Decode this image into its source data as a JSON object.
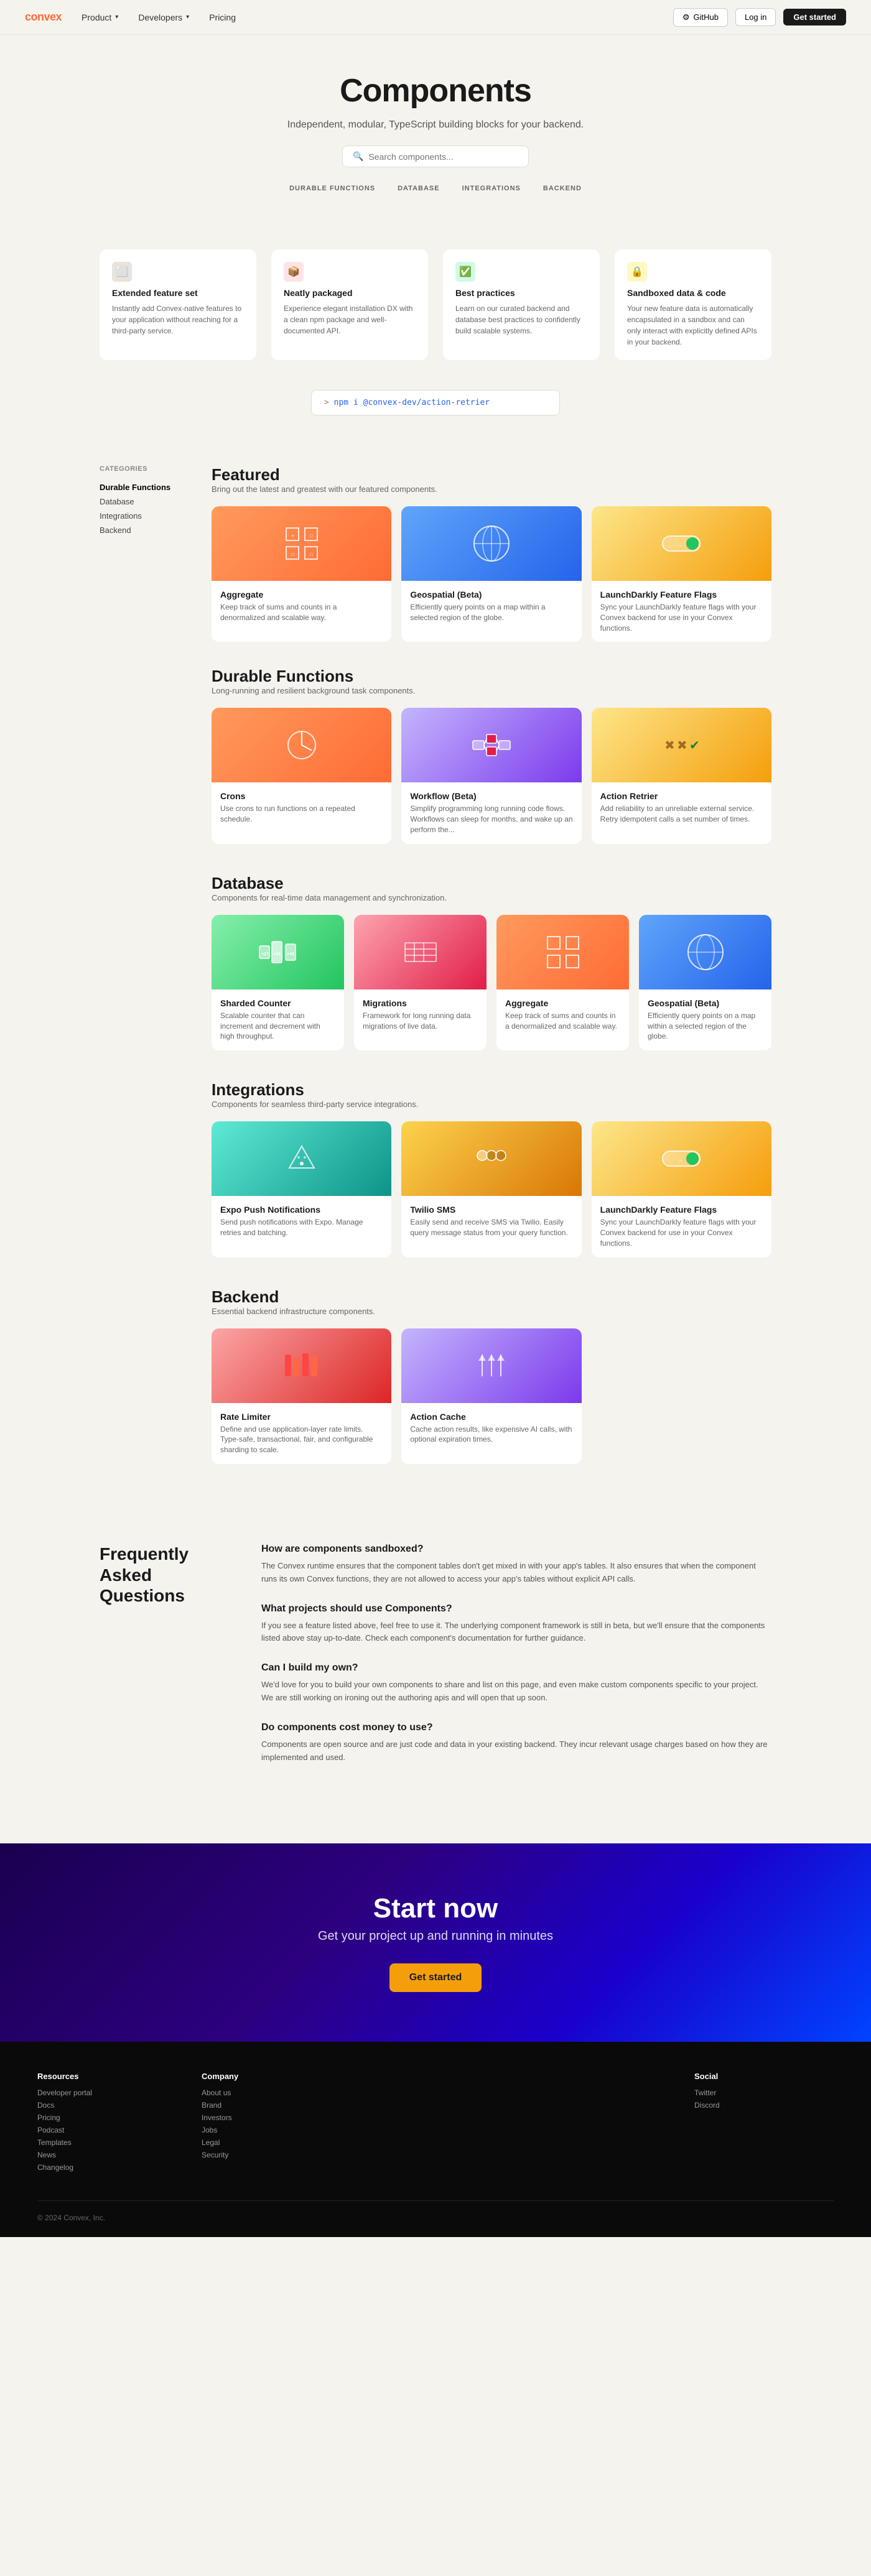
{
  "navbar": {
    "logo": "convex",
    "items": [
      {
        "label": "Product",
        "has_dropdown": true
      },
      {
        "label": "Developers",
        "has_dropdown": true
      },
      {
        "label": "Pricing",
        "has_dropdown": false
      }
    ],
    "github_label": "GitHub",
    "login_label": "Log in",
    "get_started_label": "Get started"
  },
  "hero": {
    "title": "Components",
    "subtitle": "Independent, modular, TypeScript building blocks for your backend.",
    "search_placeholder": "Search components...",
    "tags": [
      "DURABLE FUNCTIONS",
      "DATABASE",
      "INTEGRATIONS",
      "BACKEND"
    ]
  },
  "npm_command": "npm i @convex-dev/action-retrier",
  "feature_highlights": [
    {
      "icon": "⬜",
      "title": "Extended feature set",
      "desc": "Instantly add Convex-native features to your application without reaching for a third-party service.",
      "bg": "#e8e4dc"
    },
    {
      "icon": "📦",
      "title": "Neatly packaged",
      "desc": "Experience elegant installation DX with a clean npm package and well-documented API.",
      "bg": "#fff0f0"
    },
    {
      "icon": "✅",
      "title": "Best practices",
      "desc": "Learn on our curated backend and database best practices to confidently build scalable systems.",
      "bg": "#f0fff4"
    },
    {
      "icon": "🔒",
      "title": "Sandboxed data & code",
      "desc": "Your new feature data is automatically encapsulated in a sandbox and can only interact with explicitly defined APIs in your backend.",
      "bg": "#fffbf0"
    }
  ],
  "featured": {
    "title": "Featured",
    "subtitle": "Bring out the latest and greatest with our featured components.",
    "cards": [
      {
        "title": "Aggregate",
        "desc": "Keep track of sums and counts in a denormalized and scalable way.",
        "bg": "bg-orange",
        "icon": "⊞"
      },
      {
        "title": "Geospatial (Beta)",
        "desc": "Efficiently query points on a map within a selected region of the globe.",
        "bg": "bg-blue",
        "icon": "🌐"
      },
      {
        "title": "LaunchDarkly Feature Flags",
        "desc": "Sync your LaunchDarkly feature flags with your Convex backend for use in your Convex functions.",
        "bg": "bg-yellow",
        "icon": "⚡"
      }
    ]
  },
  "durable_functions": {
    "title": "Durable Functions",
    "subtitle": "Long-running and resilient background task components.",
    "cards": [
      {
        "title": "Crons",
        "desc": "Use crons to run functions on a repeated schedule.",
        "bg": "bg-orange",
        "icon": "🕐"
      },
      {
        "title": "Workflow (Beta)",
        "desc": "Simplify programming long running code flows. Workflows can sleep for months, and wake up an perform the...",
        "bg": "bg-purple",
        "icon": "🔀"
      },
      {
        "title": "Action Retrier",
        "desc": "Add reliability to an unreliable external service. Retry idempotent calls a set number of times.",
        "bg": "bg-yellow",
        "icon": "✖✔"
      }
    ]
  },
  "database": {
    "title": "Database",
    "subtitle": "Components for real-time data management and synchronization.",
    "cards": [
      {
        "title": "Sharded Counter",
        "desc": "Scalable counter that can increment and decrement with high throughput.",
        "bg": "bg-green",
        "icon": "🔢"
      },
      {
        "title": "Migrations",
        "desc": "Framework for long running data migrations of live data.",
        "bg": "bg-pink",
        "icon": "⊞"
      },
      {
        "title": "Aggregate",
        "desc": "Keep track of sums and counts in a denormalized and scalable way.",
        "bg": "bg-orange",
        "icon": "⊞"
      },
      {
        "title": "Geospatial (Beta)",
        "desc": "Efficiently query points on a map within a selected region of the globe.",
        "bg": "bg-blue",
        "icon": "🌐"
      }
    ]
  },
  "integrations": {
    "title": "Integrations",
    "subtitle": "Components for seamless third-party service integrations.",
    "cards": [
      {
        "title": "Expo Push Notifications",
        "desc": "Send push notifications with Expo. Manage retries and batching.",
        "bg": "bg-teal",
        "icon": "🔔"
      },
      {
        "title": "Twilio SMS",
        "desc": "Easily send and receive SMS via Twilio. Easily query message status from your query function.",
        "bg": "bg-amber",
        "icon": "💬"
      },
      {
        "title": "LaunchDarkly Feature Flags",
        "desc": "Sync your LaunchDarkly feature flags with your Convex backend for use in your Convex functions.",
        "bg": "bg-yellow",
        "icon": "⚡"
      }
    ]
  },
  "backend": {
    "title": "Backend",
    "subtitle": "Essential backend infrastructure components.",
    "cards": [
      {
        "title": "Rate Limiter",
        "desc": "Define and use application-layer rate limits. Type-safe, transactional, fair, and configurable sharding to scale.",
        "bg": "bg-red",
        "icon": "📊"
      },
      {
        "title": "Action Cache",
        "desc": "Cache action results, like expensive AI calls, with optional expiration times.",
        "bg": "bg-purple",
        "icon": "💾"
      }
    ]
  },
  "sidebar": {
    "title": "Categories",
    "items": [
      {
        "label": "Durable Functions",
        "id": "durable-functions"
      },
      {
        "label": "Database",
        "id": "database"
      },
      {
        "label": "Integrations",
        "id": "integrations"
      },
      {
        "label": "Backend",
        "id": "backend"
      }
    ]
  },
  "faq": {
    "title": "Frequently Asked Questions",
    "items": [
      {
        "q": "How are components sandboxed?",
        "a": "The Convex runtime ensures that the component tables don't get mixed in with your app's tables. It also ensures that when the component runs its own Convex functions, they are not allowed to access your app's tables without explicit API calls."
      },
      {
        "q": "What projects should use Components?",
        "a": "If you see a feature listed above, feel free to use it. The underlying component framework is still in beta, but we'll ensure that the components listed above stay up-to-date. Check each component's documentation for further guidance."
      },
      {
        "q": "Can I build my own?",
        "a": "We'd love for you to build your own components to share and list on this page, and even make custom components specific to your project. We are still working on ironing out the authoring apis and will open that up soon."
      },
      {
        "q": "Do components cost money to use?",
        "a": "Components are open source and are just code and data in your existing backend. They incur relevant usage charges based on how they are implemented and used."
      }
    ]
  },
  "cta": {
    "title": "Start now",
    "subtitle": "Get your project up and running\nin minutes",
    "button": "Get started"
  },
  "footer": {
    "copyright": "© 2024 Convex, Inc.",
    "columns": [
      {
        "title": "Resources",
        "links": [
          "Developer portal",
          "Docs",
          "Pricing",
          "Podcast",
          "Templates",
          "News",
          "Changelog"
        ]
      },
      {
        "title": "Company",
        "links": [
          "About us",
          "Brand",
          "Investors",
          "Jobs",
          "Legal",
          "Security"
        ]
      },
      {
        "title": "",
        "links": []
      },
      {
        "title": "",
        "links": []
      },
      {
        "title": "Social",
        "links": [
          "Twitter",
          "Discord"
        ]
      }
    ]
  }
}
